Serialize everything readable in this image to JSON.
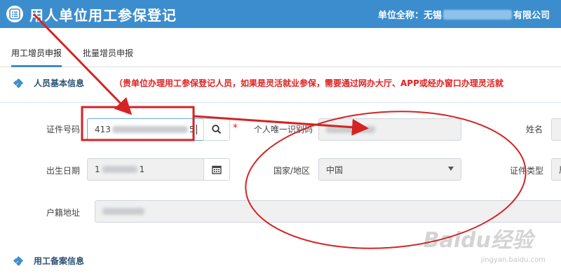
{
  "header": {
    "title": "用人单位用工参保登记",
    "unit_label": "单位全称：无锡",
    "unit_suffix": "有限公司"
  },
  "tabs": [
    {
      "label": "用工增员申报",
      "active": true
    },
    {
      "label": "批量增员申报",
      "active": false
    }
  ],
  "section_basic": {
    "title": "人员基本信息",
    "notice": "（贵单位办理用工参保登记人员，如果是灵活就业参保，需要通过网办大厅、APP或经办窗口办理灵活就"
  },
  "form": {
    "id_label": "证件号码",
    "id_value_start": "413",
    "id_value_end": "5",
    "unique_id_label": "个人唯一识别码",
    "name_label": "姓名",
    "birth_label": "出生日期",
    "birth_start": "1",
    "birth_end": "1",
    "country_label": "国家/地区",
    "country_value": "中国",
    "id_type_label": "证件类型",
    "id_type_partial": "居",
    "household_label": "户籍地址"
  },
  "section_filing": {
    "title": "用工备案信息"
  },
  "watermark": {
    "brand": "Baidu经验",
    "url": "jingyan.baidu.com"
  },
  "colors": {
    "header_bg": "#3c8dcd",
    "accent": "#3c8dcd",
    "notice_red": "#e02020",
    "annotation_red": "#d42323"
  }
}
